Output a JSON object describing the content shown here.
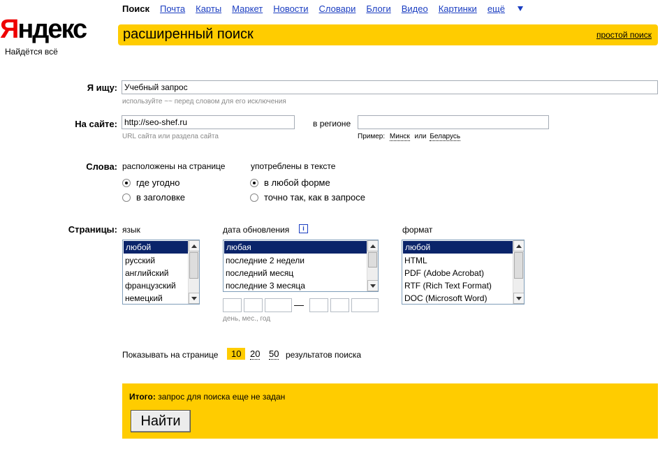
{
  "nav": {
    "current": "Поиск",
    "links": [
      "Почта",
      "Карты",
      "Маркет",
      "Новости",
      "Словари",
      "Блоги",
      "Видео",
      "Картинки"
    ],
    "more": "ещё"
  },
  "logo": {
    "first": "Я",
    "rest": "ндекс",
    "slogan": "Найдётся всё"
  },
  "header": {
    "title": "расширенный поиск",
    "simple_link": "простой поиск"
  },
  "query": {
    "label": "Я ищу:",
    "value": "Учебный запрос",
    "hint": "используйте ~~ перед словом для его исключения"
  },
  "site": {
    "label": "На сайте:",
    "value": "http://seo-shef.ru",
    "hint": "URL сайта или раздела сайта"
  },
  "region": {
    "label": "в регионе",
    "value": "",
    "example_label": "Пример:",
    "ex1": "Минск",
    "or": "или",
    "ex2": "Беларусь"
  },
  "words": {
    "label": "Слова:",
    "group1_title": "расположены на странице",
    "group1": [
      {
        "label": "где угодно",
        "checked": true
      },
      {
        "label": "в заголовке",
        "checked": false
      }
    ],
    "group2_title": "употреблены в тексте",
    "group2": [
      {
        "label": "в любой форме",
        "checked": true
      },
      {
        "label": "точно так, как в запросе",
        "checked": false
      }
    ]
  },
  "pages": {
    "label": "Страницы:",
    "lang_title": "язык",
    "lang_options": [
      "любой",
      "русский",
      "английский",
      "французский",
      "немецкий"
    ],
    "date_title": "дата обновления",
    "date_info": "i",
    "date_options": [
      "любая",
      "последние 2 недели",
      "последний месяц",
      "последние 3 месяца"
    ],
    "date_dash": "—",
    "date_hint": "день, мес., год",
    "format_title": "формат",
    "format_options": [
      "любой",
      "HTML",
      "PDF (Adobe Acrobat)",
      "RTF (Rich Text Format)",
      "DOC (Microsoft Word)"
    ]
  },
  "results": {
    "prefix": "Показывать на странице",
    "options": [
      "10",
      "20",
      "50"
    ],
    "selected": "10",
    "suffix": "результатов поиска"
  },
  "footer": {
    "total_label": "Итого:",
    "total_text": "запрос для поиска еще не задан",
    "button": "Найти"
  },
  "colors": {
    "accent": "#ffcc00",
    "link": "#1a3dc1",
    "logo_red": "#ee0000",
    "selected": "#0a246a"
  }
}
